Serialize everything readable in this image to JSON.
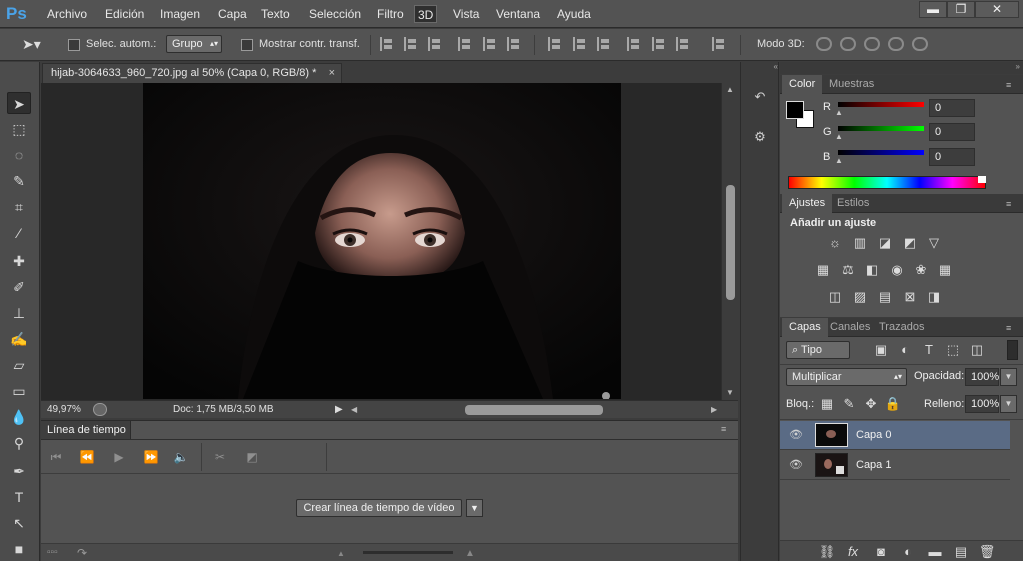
{
  "menu": {
    "logo": "Ps",
    "items": [
      "Archivo",
      "Edición",
      "Imagen",
      "Capa",
      "Texto",
      "Selección",
      "Filtro",
      "3D",
      "Vista",
      "Ventana",
      "Ayuda"
    ],
    "active_item": "3D"
  },
  "window_controls": {
    "minimize": "▬",
    "restore": "❐",
    "close": "✕"
  },
  "options": {
    "auto_select_label": "Selec. autom.:",
    "group_value": "Grupo",
    "show_transform_label": "Mostrar contr. transf.",
    "mode3d_label": "Modo 3D:"
  },
  "document": {
    "tab_title": "hijab-3064633_960_720.jpg al 50% (Capa 0, RGB/8) *",
    "zoom": "49,97%",
    "doc_info": "Doc: 1,75 MB/3,50 MB"
  },
  "timeline": {
    "tab_label": "Línea de tiempo",
    "create_button": "Crear línea de tiempo de vídeo"
  },
  "color_panel": {
    "tabs": [
      "Color",
      "Muestras"
    ],
    "channels": [
      {
        "label": "R",
        "value": "0"
      },
      {
        "label": "G",
        "value": "0"
      },
      {
        "label": "B",
        "value": "0"
      }
    ]
  },
  "adjustments_panel": {
    "tabs": [
      "Ajustes",
      "Estilos"
    ],
    "heading": "Añadir un ajuste"
  },
  "layers_panel": {
    "tabs": [
      "Capas",
      "Canales",
      "Trazados"
    ],
    "filter_value": "Tipo",
    "blend_mode": "Multiplicar",
    "opacity_label": "Opacidad:",
    "opacity_value": "100%",
    "lock_label": "Bloq.:",
    "fill_label": "Relleno:",
    "fill_value": "100%",
    "layers": [
      {
        "name": "Capa 0",
        "selected": true
      },
      {
        "name": "Capa 1",
        "selected": false
      }
    ]
  },
  "colors": {
    "app_bg": "#535353",
    "selected_layer": "#5a6b85",
    "ps_blue": "#4aa3e8"
  }
}
